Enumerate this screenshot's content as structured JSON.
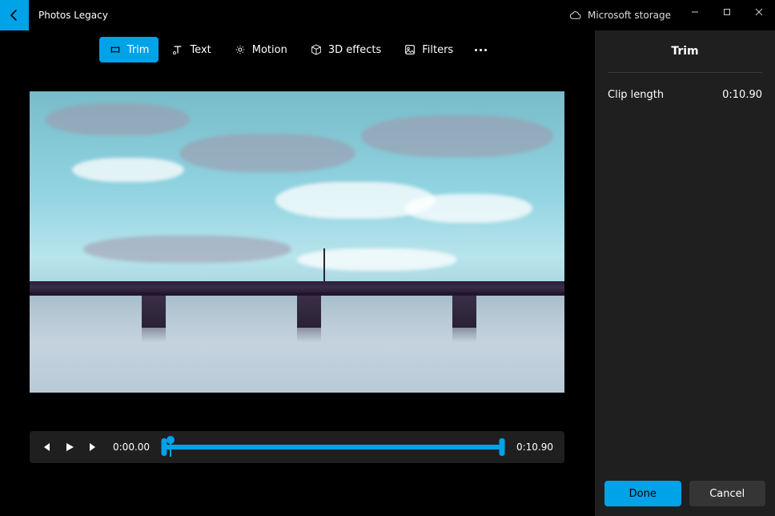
{
  "app": {
    "title": "Photos Legacy"
  },
  "storage": {
    "label": "Microsoft storage"
  },
  "toolbar": {
    "trim": "Trim",
    "text": "Text",
    "motion": "Motion",
    "effects": "3D effects",
    "filters": "Filters"
  },
  "player": {
    "start_time": "0:00.00",
    "end_time": "0:10.90"
  },
  "panel": {
    "title": "Trim",
    "clip_length_label": "Clip length",
    "clip_length_value": "0:10.90",
    "done": "Done",
    "cancel": "Cancel"
  }
}
